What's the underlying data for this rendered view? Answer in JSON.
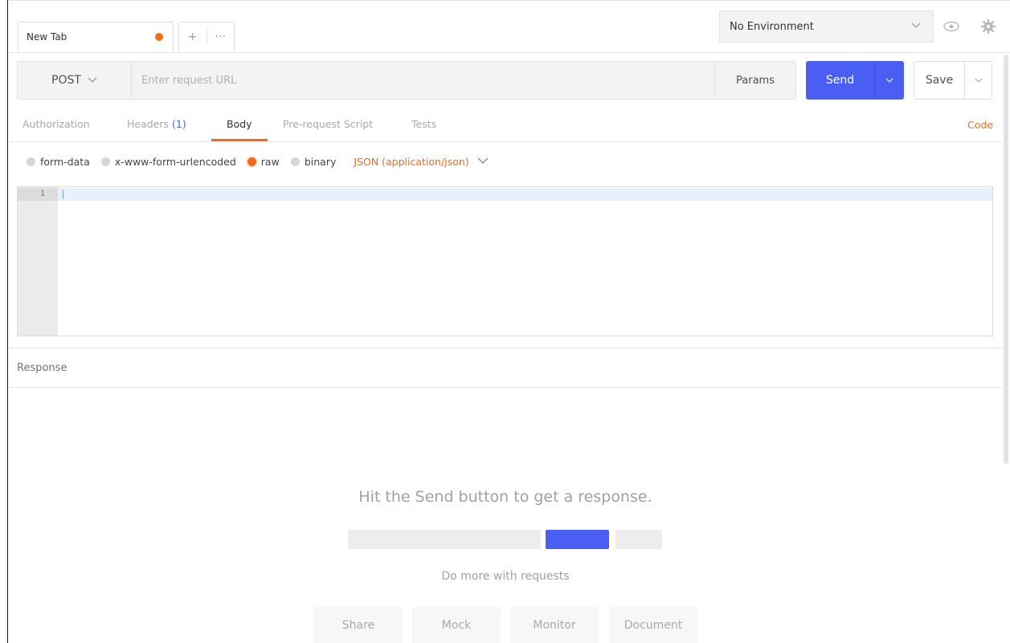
{
  "tabbar": {
    "tab_label": "New Tab",
    "unsaved_color": "#f26b1d",
    "add_tab_glyph": "+",
    "more_glyph": "···"
  },
  "environment": {
    "selected": "No Environment",
    "chevron_icon": "chevron-down-icon",
    "eye_icon": "eye-icon",
    "settings_icon": "gear-icon"
  },
  "request": {
    "method": "POST",
    "url_value": "",
    "url_placeholder": "Enter request URL",
    "params_label": "Params",
    "send_label": "Send",
    "save_label": "Save"
  },
  "request_tabs": {
    "items": [
      {
        "label": "Authorization"
      },
      {
        "label": "Headers",
        "count": "(1)"
      },
      {
        "label": "Body"
      },
      {
        "label": "Pre-request Script"
      },
      {
        "label": "Tests"
      }
    ],
    "active": "Body",
    "code_label": "Code"
  },
  "body": {
    "types": [
      {
        "label": "form-data",
        "checked": false
      },
      {
        "label": "x-www-form-urlencoded",
        "checked": false
      },
      {
        "label": "raw",
        "checked": true
      },
      {
        "label": "binary",
        "checked": false
      }
    ],
    "content_type": "JSON (application/json)",
    "editor_line_numbers": [
      "1"
    ]
  },
  "response": {
    "title": "Response",
    "empty_message": "Hit the Send button to get a response.",
    "more_label": "Do more with requests",
    "actions": [
      "Share",
      "Mock",
      "Monitor",
      "Document"
    ]
  },
  "colors": {
    "accent": "#f26b1d",
    "primary": "#4a5ef4"
  }
}
